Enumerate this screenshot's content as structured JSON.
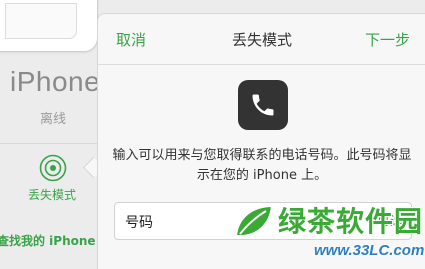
{
  "background": {
    "device_name": "iPhone",
    "device_status": "离线",
    "lost_mode_label": "丢失模式",
    "find_link": "查找我的 iPhone"
  },
  "sheet": {
    "cancel_label": "取消",
    "title": "丢失模式",
    "next_label": "下一步",
    "icon": "phone-icon",
    "description": "输入可以用来与您取得联系的电话号码。此号码将显示在您的 iPhone 上。",
    "number_label": "号码",
    "number_placeholder": "可选"
  },
  "watermark": {
    "brand": "绿茶软件园",
    "url": "www.33LC.com"
  },
  "colors": {
    "accent": "#39a34a",
    "text": "#333333",
    "sheet_bg": "#f7f7f7",
    "badge_bg": "#333333"
  }
}
